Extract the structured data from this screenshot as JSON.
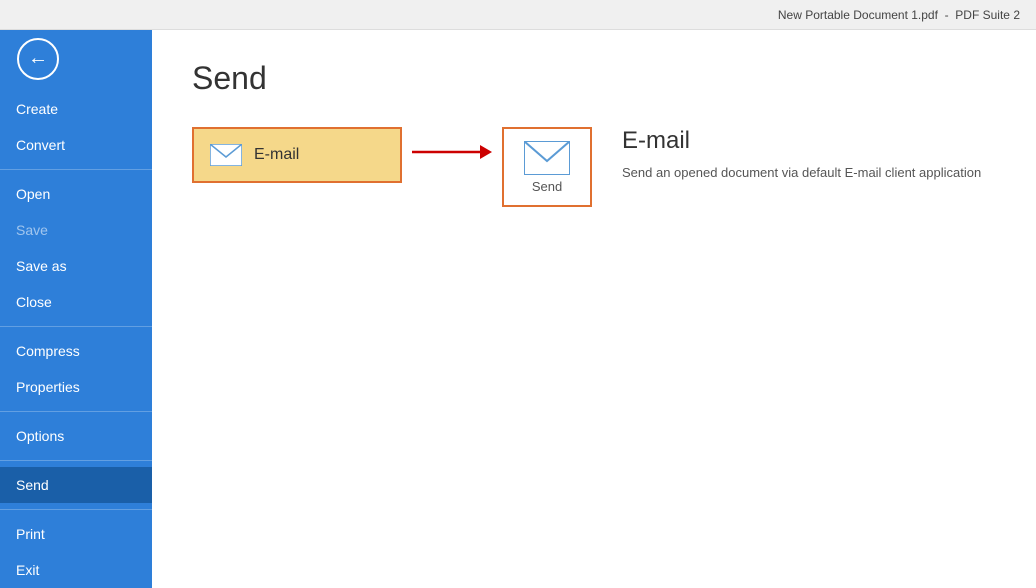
{
  "titlebar": {
    "filename": "New Portable Document 1.pdf",
    "separator": "-",
    "app": "PDF Suite 2"
  },
  "sidebar": {
    "items": [
      {
        "id": "create",
        "label": "Create",
        "active": false,
        "disabled": false
      },
      {
        "id": "convert",
        "label": "Convert",
        "active": false,
        "disabled": false
      },
      {
        "id": "open",
        "label": "Open",
        "active": false,
        "disabled": false
      },
      {
        "id": "save",
        "label": "Save",
        "active": false,
        "disabled": true
      },
      {
        "id": "save-as",
        "label": "Save as",
        "active": false,
        "disabled": false
      },
      {
        "id": "close",
        "label": "Close",
        "active": false,
        "disabled": false
      },
      {
        "id": "compress",
        "label": "Compress",
        "active": false,
        "disabled": false
      },
      {
        "id": "properties",
        "label": "Properties",
        "active": false,
        "disabled": false
      },
      {
        "id": "options",
        "label": "Options",
        "active": false,
        "disabled": false
      },
      {
        "id": "send",
        "label": "Send",
        "active": true,
        "disabled": false
      },
      {
        "id": "print",
        "label": "Print",
        "active": false,
        "disabled": false
      },
      {
        "id": "exit",
        "label": "Exit",
        "active": false,
        "disabled": false
      }
    ]
  },
  "content": {
    "page_title": "Send",
    "email_button_label": "E-mail",
    "send_icon_label": "Send",
    "description": {
      "title": "E-mail",
      "text": "Send an opened document via default E-mail client application"
    }
  }
}
